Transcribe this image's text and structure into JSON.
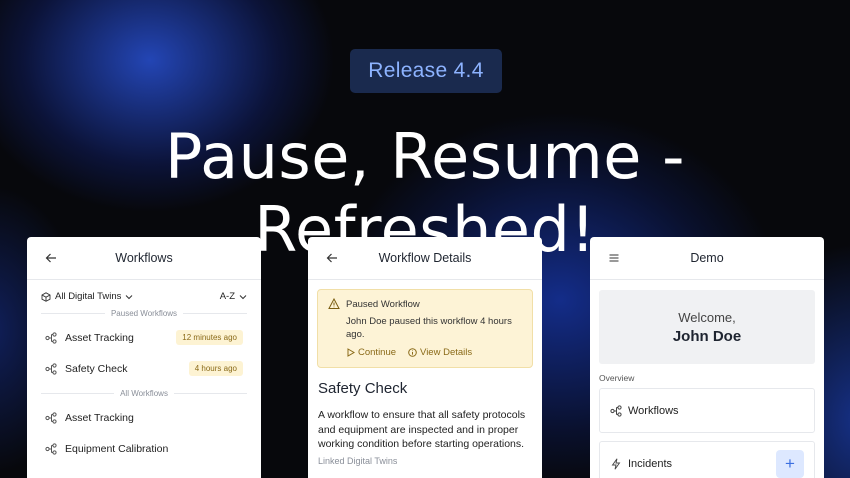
{
  "badge": "Release 4.4",
  "headline": "Pause, Resume - Refreshed!",
  "workflows_card": {
    "title": "Workflows",
    "filter": "All Digital Twins",
    "sort": "A-Z",
    "paused_section": "Paused Workflows",
    "paused_items": [
      {
        "name": "Asset Tracking",
        "time": "12 minutes ago"
      },
      {
        "name": "Safety Check",
        "time": "4 hours ago"
      }
    ],
    "all_section": "All Workflows",
    "all_items": [
      {
        "name": "Asset Tracking"
      },
      {
        "name": "Equipment Calibration"
      }
    ]
  },
  "details_card": {
    "title": "Workflow Details",
    "alert_title": "Paused Workflow",
    "alert_body": "John Doe paused this workflow 4 hours ago.",
    "continue_label": "Continue",
    "view_details_label": "View Details",
    "workflow_name": "Safety Check",
    "description": "A workflow to ensure that all safety protocols and equipment are inspected and in proper working condition before starting operations.",
    "linked_label": "Linked Digital Twins"
  },
  "demo_card": {
    "title": "Demo",
    "welcome": "Welcome,",
    "user": "John Doe",
    "overview": "Overview",
    "items": [
      {
        "name": "Workflows",
        "icon": "workflow-icon"
      },
      {
        "name": "Incidents",
        "icon": "lightning-icon"
      }
    ],
    "add_label": "+"
  }
}
